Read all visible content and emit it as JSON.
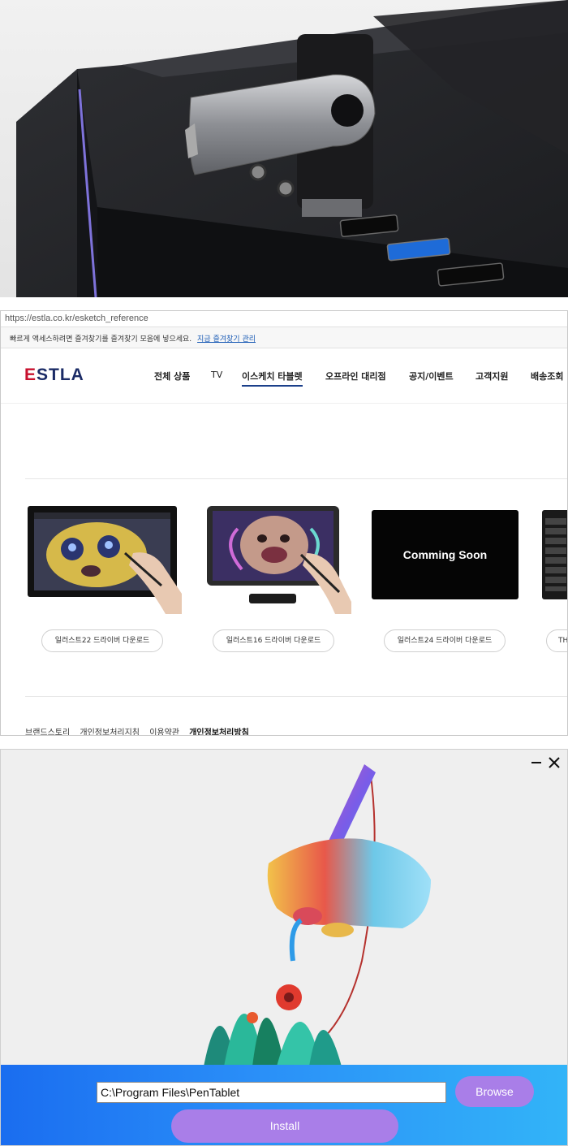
{
  "browser": {
    "url": "https://estla.co.kr/esketch_reference",
    "favorites_bar": {
      "text": "빠르게 액세스하려면 즐겨찾기를 즐겨찾기 모음에 넣으세요.",
      "link": "지금 즐겨찾기 관리"
    },
    "logo": {
      "part1": "E",
      "part2": "STLA"
    },
    "nav": [
      {
        "label": "전체 상품"
      },
      {
        "label": "TV"
      },
      {
        "label": "이스케치 타블렛"
      },
      {
        "label": "오프라인 대리점"
      },
      {
        "label": "공지/이벤트"
      },
      {
        "label": "고객지원"
      },
      {
        "label": "배송조회"
      }
    ],
    "products": [
      {
        "download_label": "일러스트22 드라이버 다운로드"
      },
      {
        "download_label": "일러스트16 드라이버 다운로드"
      },
      {
        "screen_text": "Comming Soon",
        "download_label": "일러스트24 드라이버 다운로드"
      },
      {
        "download_label": "TH"
      }
    ],
    "footer": [
      "브랜드스토리",
      "개인정보처리지침",
      "이용약관",
      "개인정보처리방침"
    ]
  },
  "installer": {
    "minimize_icon": "minimize-icon",
    "close_icon": "close-icon",
    "install_path": "C:\\Program Files\\PenTablet",
    "browse_label": "Browse",
    "install_label": "Install"
  },
  "colors": {
    "brand_navy": "#1b2b66",
    "brand_red": "#c8102e",
    "installer_button": "#a97ee8",
    "installer_bar_start": "#1a6df0",
    "installer_bar_end": "#32b4f8"
  }
}
